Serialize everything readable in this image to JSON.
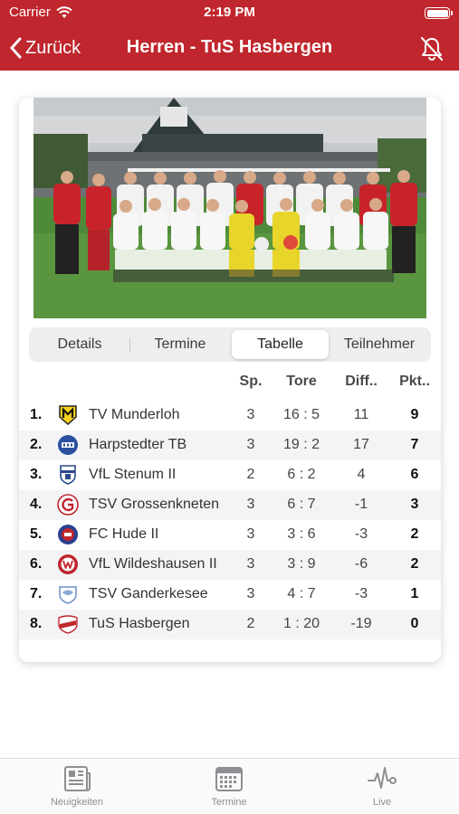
{
  "status_bar": {
    "carrier": "Carrier",
    "time": "2:19 PM"
  },
  "nav": {
    "back_label": "Zurück",
    "title": "Herren - TuS Hasbergen"
  },
  "segments": [
    "Details",
    "Termine",
    "Tabelle",
    "Teilnehmer"
  ],
  "active_segment": "Tabelle",
  "table": {
    "headers": {
      "games": "Sp.",
      "goals": "Tore",
      "diff": "Diff..",
      "points": "Pkt.."
    },
    "rows": [
      {
        "rank": "1.",
        "team": "TV Munderloh",
        "games": "3",
        "goals": "16 : 5",
        "diff": "11",
        "points": "9",
        "logo": "munderloh-crest-icon"
      },
      {
        "rank": "2.",
        "team": "Harpstedter TB",
        "games": "3",
        "goals": "19 : 2",
        "diff": "17",
        "points": "7",
        "logo": "htb-crest-icon"
      },
      {
        "rank": "3.",
        "team": "VfL Stenum II",
        "games": "2",
        "goals": "6 : 2",
        "diff": "4",
        "points": "6",
        "logo": "stenum-crest-icon"
      },
      {
        "rank": "4.",
        "team": "TSV Grossenkneten",
        "games": "3",
        "goals": "6 : 7",
        "diff": "-1",
        "points": "3",
        "logo": "grossenkneten-crest-icon"
      },
      {
        "rank": "5.",
        "team": "FC Hude II",
        "games": "3",
        "goals": "3 : 6",
        "diff": "-3",
        "points": "2",
        "logo": "hude-crest-icon"
      },
      {
        "rank": "6.",
        "team": "VfL Wildeshausen II",
        "games": "3",
        "goals": "3 : 9",
        "diff": "-6",
        "points": "2",
        "logo": "wildeshausen-crest-icon"
      },
      {
        "rank": "7.",
        "team": "TSV Ganderkesee",
        "games": "3",
        "goals": "4 : 7",
        "diff": "-3",
        "points": "1",
        "logo": "ganderkesee-crest-icon"
      },
      {
        "rank": "8.",
        "team": "TuS Hasbergen",
        "games": "2",
        "goals": "1 : 20",
        "diff": "-19",
        "points": "0",
        "logo": "hasbergen-crest-icon"
      }
    ]
  },
  "tabbar": [
    {
      "label": "Neuigkeiten",
      "icon": "newspaper-icon"
    },
    {
      "label": "Termine",
      "icon": "calendar-icon"
    },
    {
      "label": "Live",
      "icon": "pulse-icon"
    }
  ],
  "colors": {
    "brand": "#c0262d"
  }
}
